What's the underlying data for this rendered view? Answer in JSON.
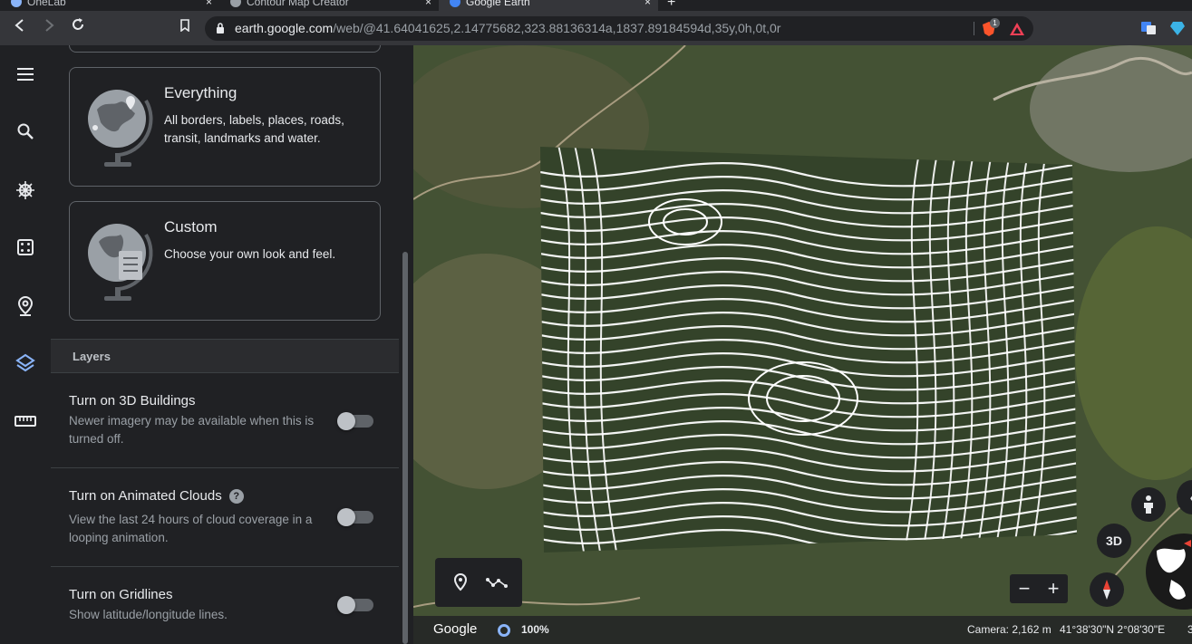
{
  "browser": {
    "tabs": [
      {
        "label": "OneLab",
        "icon_color": "#8ab4f8"
      },
      {
        "label": "Contour Map Creator",
        "icon_color": "#9aa0a6"
      },
      {
        "label": "Google Earth",
        "icon_color": "#4285f4"
      }
    ],
    "close_glyph": "×",
    "new_tab_glyph": "+",
    "url_host": "earth.google.com",
    "url_path": "/web/@41.64041625,2.14775682,323.88136314a,1837.89184594d,35y,0h,0t,0r",
    "brave_badge": "1"
  },
  "panel": {
    "cards": [
      {
        "title": "Everything",
        "description": "All borders, labels, places, roads, transit, landmarks and water."
      },
      {
        "title": "Custom",
        "description": "Choose your own look and feel."
      }
    ],
    "layers_title": "Layers",
    "layers": [
      {
        "title": "Turn on 3D Buildings",
        "description": "Newer imagery may be available when this is turned off.",
        "enabled": false
      },
      {
        "title": "Turn on Animated Clouds",
        "description": "View the last 24 hours of cloud coverage in a looping animation.",
        "enabled": false,
        "help": "?"
      },
      {
        "title": "Turn on Gridlines",
        "description": "Show latitude/longitude lines.",
        "enabled": false
      }
    ]
  },
  "map": {
    "view_3d_label": "3D",
    "zoom_out": "−",
    "zoom_in": "+",
    "brand": "Google",
    "load_percent": "100%",
    "camera": "Camera: 2,162 m",
    "coordinates": "41°38'30\"N 2°08'30\"E",
    "coordinates_overflow": "3"
  }
}
